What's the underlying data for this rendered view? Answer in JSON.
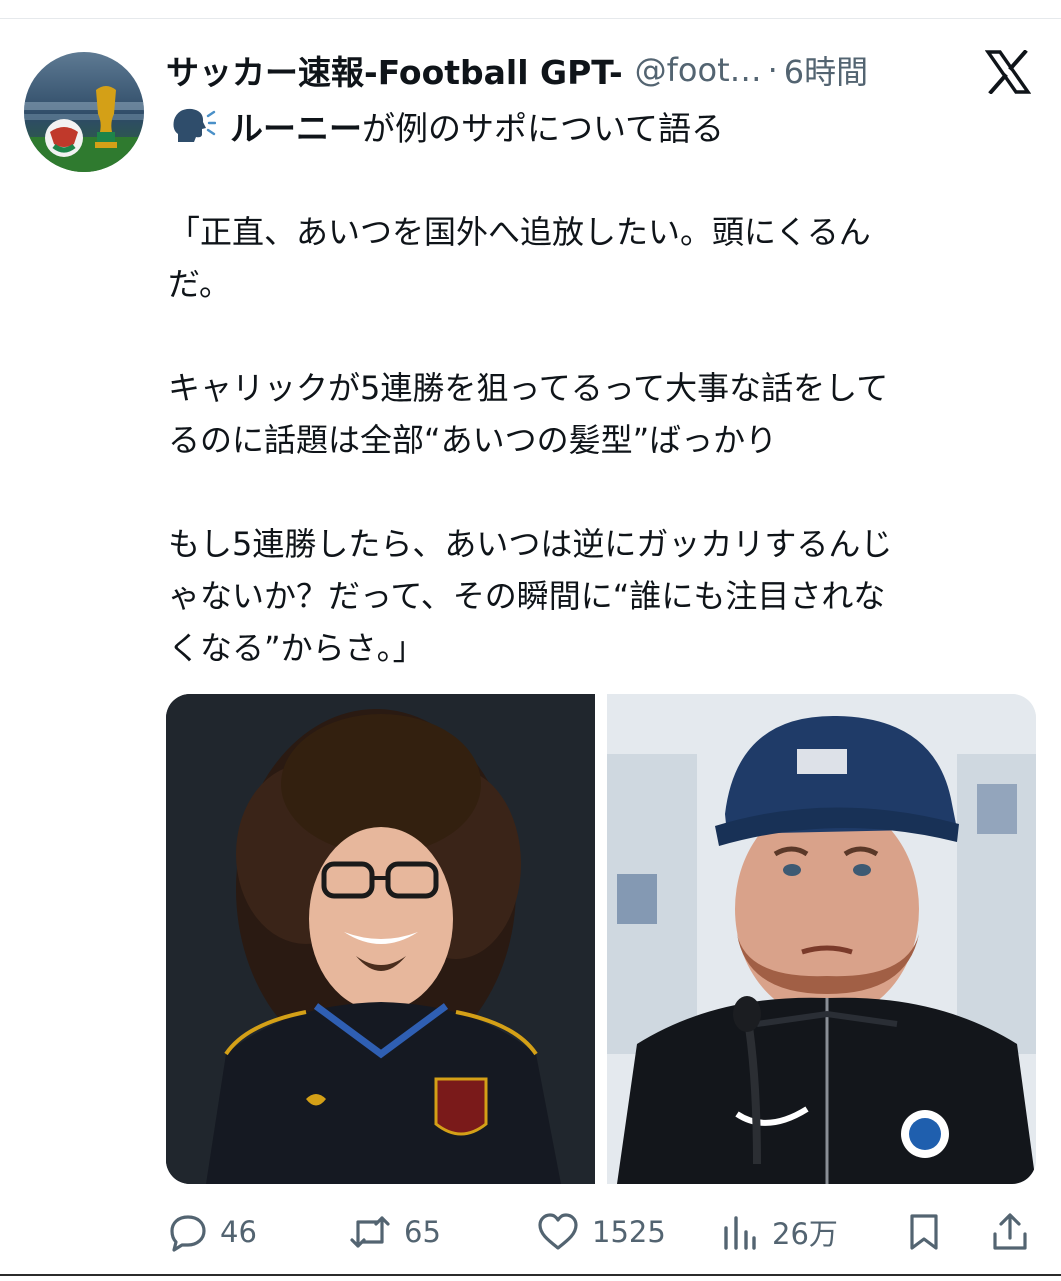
{
  "post": {
    "author_name": "サッカー速報-Football GPT-",
    "handle": "@foot…",
    "separator": "·",
    "time": "6時間",
    "headline_bold": "ルーニー",
    "headline_rest": "が例のサポについて語る",
    "paragraphs": [
      "「正直、あいつを国外へ追放したい。頭にくるん\nだ。",
      "キャリックが5連勝を狙ってるって大事な話をして\nるのに話題は全部“あいつの髪型”ばっかり",
      "もし5連勝したら、あいつは逆にガッカリするんじ\nゃないか？だって、その瞬間に“誰にも注目されな\nくなる”からさ。」"
    ]
  },
  "icons": {
    "platform": "x-logo-icon",
    "headline": "speaking-head-icon",
    "reply": "reply-icon",
    "repost": "repost-icon",
    "like": "heart-icon",
    "views": "views-icon",
    "bookmark": "bookmark-icon",
    "share": "share-icon"
  },
  "actions": {
    "replies": "46",
    "reposts": "65",
    "likes": "1525",
    "views": "26万"
  },
  "colors": {
    "text": "#0f1419",
    "secondary": "#536471",
    "background": "#ffffff"
  }
}
